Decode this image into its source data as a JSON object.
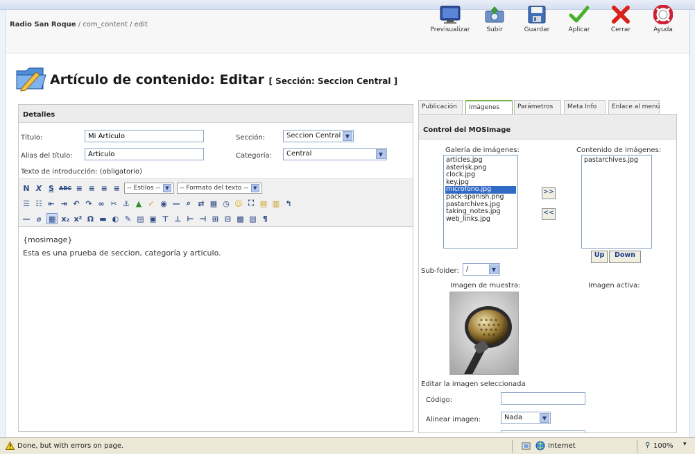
{
  "header": {
    "breadcrumb_bold": "Radio San Roque",
    "breadcrumb_rest": "/ com_content / edit",
    "toolbar": [
      {
        "label": "Previsualizar",
        "icon": "preview-icon"
      },
      {
        "label": "Subir",
        "icon": "upload-icon"
      },
      {
        "label": "Guardar",
        "icon": "save-icon"
      },
      {
        "label": "Aplicar",
        "icon": "apply-icon"
      },
      {
        "label": "Cerrar",
        "icon": "close-icon"
      },
      {
        "label": "Ayuda",
        "icon": "help-icon"
      }
    ]
  },
  "page": {
    "title": "Artículo de contenido:",
    "action": "Editar",
    "section_label": "[ Sección: Seccion Central ]"
  },
  "details": {
    "heading": "Detalles",
    "titulo_label": "Título:",
    "titulo_value": "Mi Artículo",
    "alias_label": "Alias del título:",
    "alias_value": "Articulo",
    "seccion_label": "Sección:",
    "seccion_value": "Seccion Central",
    "categoria_label": "Categoría:",
    "categoria_value": "Central",
    "intro_label": "Texto de introducción: (obligatorio)",
    "styles_select": "-- Estilos --",
    "format_select": "-- Formato del texto --",
    "editor_line1": "{mosimage}",
    "editor_line2": "Esta es una prueba de seccion, categoría y articulo."
  },
  "tabs": [
    "Publicación",
    "Imágenes",
    "Parámetros",
    "Meta Info",
    "Enlace al menú"
  ],
  "mosimage": {
    "heading": "Control del MOSImage",
    "gallery_label": "Galería de imágenes:",
    "gallery_items": [
      "articles.jpg",
      "asterisk.png",
      "clock.jpg",
      "key.jpg",
      "microfono.jpg",
      "pack-spanish.png",
      "pastarchives.jpg",
      "taking_notes.jpg",
      "web_links.jpg"
    ],
    "gallery_selected_index": 4,
    "content_label": "Contenido de imágenes:",
    "content_items": [
      "pastarchives.jpg"
    ],
    "add_button": ">>",
    "remove_button": "<<",
    "up_button": "Up",
    "down_button": "Down",
    "subfolder_label": "Sub-folder:",
    "subfolder_value": "/",
    "sample_label": "Imagen de muestra:",
    "active_label": "Imagen activa:",
    "edit_label": "Editar la imagen seleccionada",
    "codigo_label": "Código:",
    "align_label": "Alinear imagen:",
    "align_value": "Nada"
  },
  "status": {
    "text": "Done, but with errors on page.",
    "zone": "Internet",
    "zoom": "100%"
  },
  "colors": {
    "accent_blue": "#316ac5",
    "tab_active_green": "#78b050",
    "status_bg": "#ece9d8"
  }
}
